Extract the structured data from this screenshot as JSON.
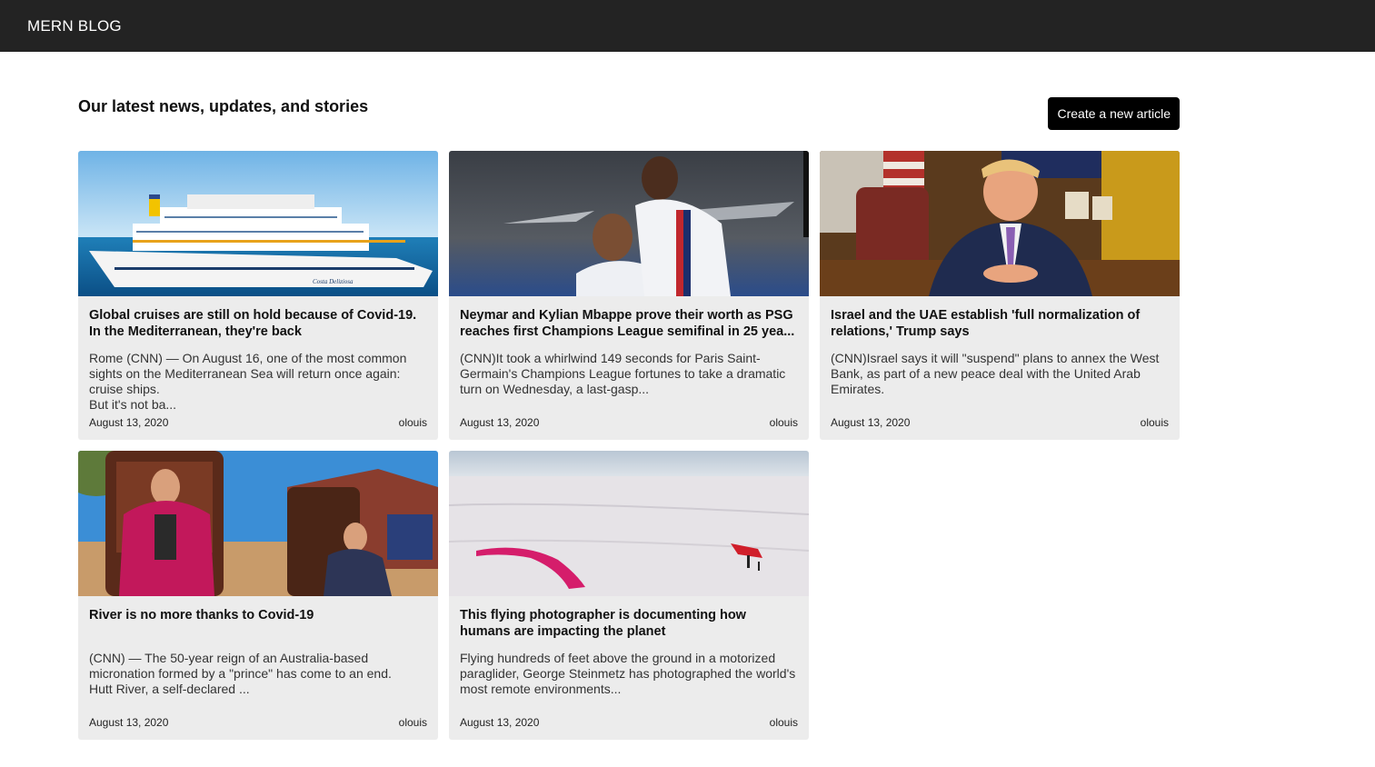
{
  "header": {
    "brand": "MERN BLOG"
  },
  "page": {
    "title": "Our latest news, updates, and stories",
    "create_button": "Create a new article"
  },
  "articles": [
    {
      "title": "Global cruises are still on hold because of Covid-19. In the Mediterranean, they're back",
      "excerpt": "Rome (CNN) — On August 16, one of the most common sights on the Mediterranean Sea will return once again: cruise ships.\nBut it's not ba...",
      "date": "August 13, 2020",
      "author": "olouis",
      "image": "cruise-ship-image"
    },
    {
      "title": "Neymar and Kylian Mbappe prove their worth as PSG reaches first Champions League semifinal in 25 yea...",
      "excerpt": "(CNN)It took a whirlwind 149 seconds for Paris Saint-Germain's Champions League fortunes to take a dramatic turn on Wednesday, a last-gasp...",
      "date": "August 13, 2020",
      "author": "olouis",
      "image": "football-players-image"
    },
    {
      "title": "Israel and the UAE establish 'full normalization of relations,' Trump says",
      "excerpt": "(CNN)Israel says it will \"suspend\" plans to annex the West Bank, as part of a new peace deal with the United Arab Emirates.",
      "date": "August 13, 2020",
      "author": "olouis",
      "image": "oval-office-image"
    },
    {
      "title": "River is no more thanks to Covid-19",
      "excerpt": "(CNN) — The 50-year reign of an Australia-based micronation formed by a \"prince\" has come to an end.\nHutt River, a self-declared ...",
      "date": "August 13, 2020",
      "author": "olouis",
      "image": "throne-couple-image"
    },
    {
      "title": "This flying photographer is documenting how humans are impacting the planet",
      "excerpt": "Flying hundreds of feet above the ground in a motorized paraglider, George Steinmetz has photographed the world's most remote environments...",
      "date": "August 13, 2020",
      "author": "olouis",
      "image": "salt-flat-helicopter-image"
    }
  ]
}
